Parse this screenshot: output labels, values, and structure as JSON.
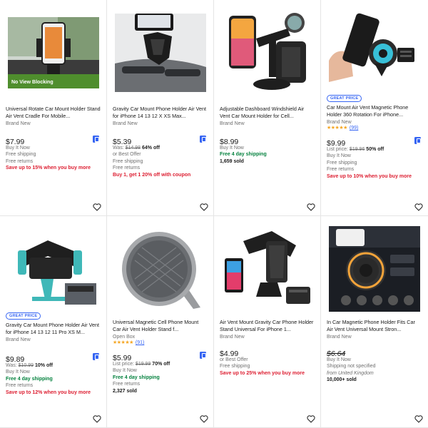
{
  "items": [
    {
      "title": "Universal Rotate Car Mount Holder Stand Air Vent Cradle For Mobile...",
      "image_overlay": "No View Blocking",
      "condition": "Brand New",
      "price": "$7.99",
      "bookmark": true,
      "lines": [
        "Buy It Now",
        "Free shipping",
        "Free returns"
      ],
      "promo": "Save up to 15% when you buy more"
    },
    {
      "title": "Gravity Car Mount Phone Holder Air Vent for iPhone 14 13 12 X XS Max...",
      "condition": "Brand New",
      "price": "$5.39",
      "bookmark": true,
      "was_label": "Was:",
      "was_price": "$14.98",
      "discount": "64% off",
      "lines": [
        "or Best Offer",
        "Free shipping",
        "Free returns"
      ],
      "promo": "Buy 1, get 1 20% off with coupon"
    },
    {
      "title": "Adjustable Dashboard Windshield Air Vent Car Mount Holder for Cell...",
      "condition": "Brand New",
      "price": "$8.99",
      "lines": [
        "Buy It Now"
      ],
      "shipping": "Free 4 day shipping",
      "sold": "1,659 sold"
    },
    {
      "badge": "GREAT PRICE",
      "title": "Car Mount Air Vent Magnetic Phone Holder 360 Rotation For iPhone...",
      "condition": "Brand New",
      "stars": "★★★★★",
      "reviews": "(99)",
      "price": "$9.99",
      "bookmark": true,
      "was_label": "List price:",
      "was_price": "$19.96",
      "discount": "50% off",
      "lines": [
        "Buy It Now",
        "Free shipping",
        "Free returns"
      ],
      "promo": "Save up to 10% when you buy more"
    },
    {
      "badge": "GREAT PRICE",
      "title": "Gravity Car Mount Phone Holder Air Vent for iPhone 14 13 12 11 Pro XS M...",
      "condition": "Brand New",
      "price": "$9.89",
      "bookmark": true,
      "was_label": "Was:",
      "was_price": "$10.99",
      "discount": "10% off",
      "lines": [
        "Buy It Now"
      ],
      "shipping": "Free 4 day shipping",
      "lines_after": [
        "Free returns"
      ],
      "promo": "Save up to 12% when you buy more"
    },
    {
      "title": "Universal Magnetic Cell Phone Mount Car Air Vent Holder Stand f...",
      "condition": "Open Box",
      "stars": "★★★★★",
      "reviews": "(91)",
      "price": "$5.99",
      "bookmark": true,
      "was_label": "List price:",
      "was_price": "$19.99",
      "discount": "70% off",
      "lines": [
        "Buy It Now"
      ],
      "shipping": "Free 4 day shipping",
      "lines_after": [
        "Free returns"
      ],
      "sold": "2,327 sold"
    },
    {
      "title": "Air Vent Mount Gravity Car Phone Holder Stand Universal For iPhone 1...",
      "condition": "Brand New",
      "price": "$4.99",
      "lines": [
        "or Best Offer",
        "Free shipping"
      ],
      "promo": "Save up to 25% when you buy more"
    },
    {
      "title": "In Car Magnetic Phone Holder Fits Car Air Vent Universal Mount Stron...",
      "condition": "Brand New",
      "price": "$6.64",
      "price_strike": true,
      "lines": [
        "Buy It Now",
        "Shipping not specified"
      ],
      "from": "from United Kingdom",
      "sold": "10,000+ sold"
    }
  ],
  "colors": {
    "accent": "#3665f3",
    "promo": "#dd1e31",
    "shipping": "#05823f",
    "stars": "#f5a623"
  },
  "icons": {
    "watch": "heart-icon",
    "bookmark": "bookmark-icon"
  }
}
